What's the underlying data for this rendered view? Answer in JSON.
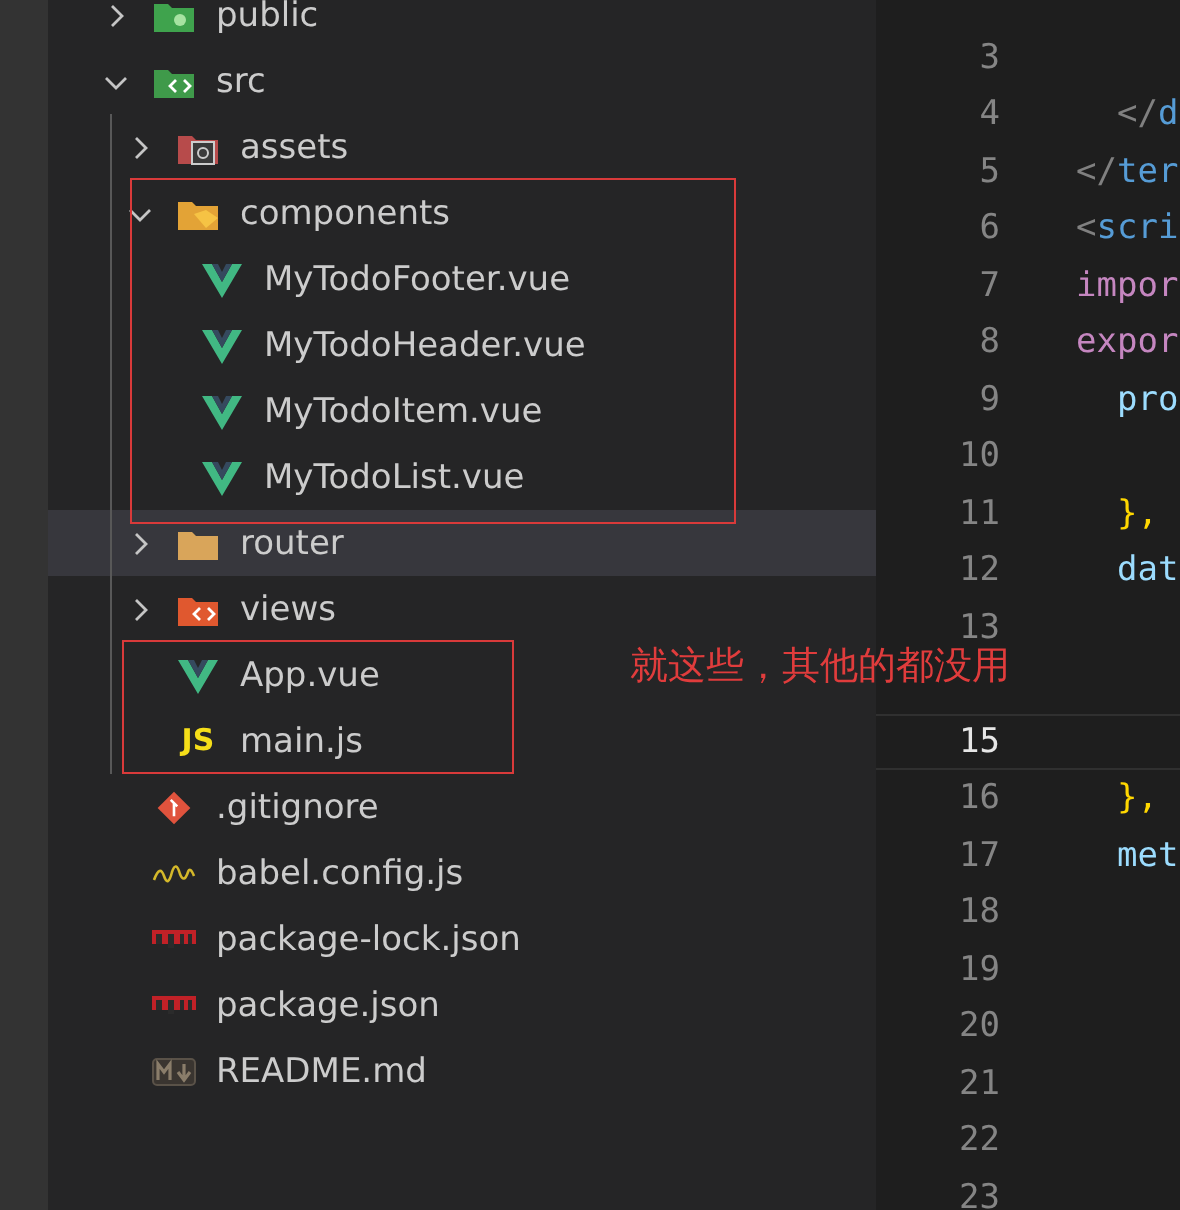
{
  "explorer": {
    "tree": [
      {
        "name": "public",
        "kind": "folder-public",
        "expanded": false,
        "selected": false
      },
      {
        "name": "src",
        "kind": "folder-src",
        "expanded": true,
        "selected": false,
        "children": [
          {
            "name": "assets",
            "kind": "folder-assets",
            "expanded": false,
            "selected": false
          },
          {
            "name": "components",
            "kind": "folder-components",
            "expanded": true,
            "selected": false,
            "children": [
              {
                "name": "MyTodoFooter.vue",
                "kind": "vue",
                "selected": false
              },
              {
                "name": "MyTodoHeader.vue",
                "kind": "vue",
                "selected": false
              },
              {
                "name": "MyTodoItem.vue",
                "kind": "vue",
                "selected": false
              },
              {
                "name": "MyTodoList.vue",
                "kind": "vue",
                "selected": false
              }
            ]
          },
          {
            "name": "router",
            "kind": "folder-plain",
            "expanded": false,
            "selected": true
          },
          {
            "name": "views",
            "kind": "folder-views",
            "expanded": false,
            "selected": false
          },
          {
            "name": "App.vue",
            "kind": "vue",
            "selected": false
          },
          {
            "name": "main.js",
            "kind": "js",
            "badge": "JS",
            "selected": false
          }
        ]
      },
      {
        "name": ".gitignore",
        "kind": "git",
        "selected": false
      },
      {
        "name": "babel.config.js",
        "kind": "babel",
        "selected": false
      },
      {
        "name": "package-lock.json",
        "kind": "npm",
        "selected": false
      },
      {
        "name": "package.json",
        "kind": "npm",
        "selected": false
      },
      {
        "name": "README.md",
        "kind": "markdown",
        "selected": false
      }
    ]
  },
  "note": "就这些，其他的都没用",
  "editor": {
    "lines": [
      {
        "number": "3",
        "current": false
      },
      {
        "number": "4",
        "current": false,
        "tokens": [
          {
            "text": "  </",
            "kind": "punct"
          },
          {
            "text": "d",
            "kind": "tag"
          }
        ]
      },
      {
        "number": "5",
        "current": false,
        "tokens": [
          {
            "text": "</",
            "kind": "punct"
          },
          {
            "text": "ter",
            "kind": "tag"
          }
        ]
      },
      {
        "number": "6",
        "current": false,
        "tokens": [
          {
            "text": "<",
            "kind": "punct"
          },
          {
            "text": "scri",
            "kind": "tag"
          }
        ]
      },
      {
        "number": "7",
        "current": false,
        "tokens": [
          {
            "text": "impor",
            "kind": "keyword"
          }
        ]
      },
      {
        "number": "8",
        "current": false,
        "tokens": [
          {
            "text": "expor",
            "kind": "keyword"
          }
        ]
      },
      {
        "number": "9",
        "current": false,
        "tokens": [
          {
            "text": "  pro",
            "kind": "property"
          }
        ]
      },
      {
        "number": "10",
        "current": false
      },
      {
        "number": "11",
        "current": false,
        "tokens": [
          {
            "text": "  },",
            "kind": "brace"
          }
        ]
      },
      {
        "number": "12",
        "current": false,
        "tokens": [
          {
            "text": "  dat",
            "kind": "property"
          }
        ]
      },
      {
        "number": "13",
        "current": false
      },
      {
        "current": false
      },
      {
        "number": "15",
        "current": true
      },
      {
        "number": "16",
        "current": false,
        "tokens": [
          {
            "text": "  },",
            "kind": "brace"
          }
        ]
      },
      {
        "number": "17",
        "current": false,
        "tokens": [
          {
            "text": "  met",
            "kind": "property"
          }
        ]
      },
      {
        "number": "18",
        "current": false
      },
      {
        "number": "19",
        "current": false
      },
      {
        "number": "20",
        "current": false
      },
      {
        "number": "21",
        "current": false
      },
      {
        "number": "22",
        "current": false
      },
      {
        "number": "23",
        "current": false
      }
    ]
  }
}
